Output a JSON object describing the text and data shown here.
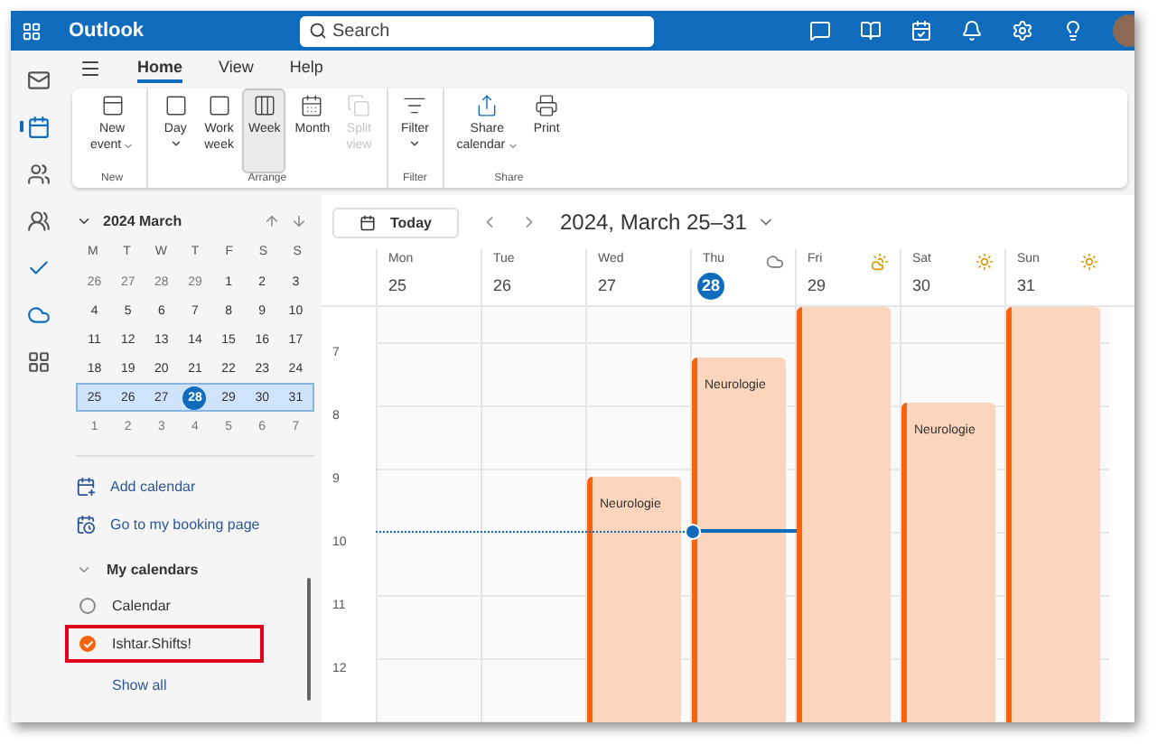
{
  "top_bar": {
    "app_name": "Outlook",
    "search": {
      "placeholder": "Search"
    }
  },
  "rail": [
    {
      "selected": false
    },
    {
      "selected": true
    },
    {
      "selected": false
    },
    {
      "selected": false
    },
    {
      "selected": false
    },
    {
      "selected": false
    },
    {
      "selected": false
    }
  ],
  "ribbon_tabs": [
    {
      "label": "Home",
      "selected": true
    },
    {
      "label": "View",
      "selected": false
    },
    {
      "label": "Help",
      "selected": false
    }
  ],
  "ribbon_groups": [
    {
      "label": "New",
      "buttons": [
        {
          "lines": [
            "New",
            "event"
          ],
          "dropdown": true,
          "selected": false,
          "disabled": false
        }
      ]
    },
    {
      "label": "Arrange",
      "buttons": [
        {
          "lines": [
            "Day"
          ],
          "dropdown": true,
          "selected": false,
          "disabled": false
        },
        {
          "lines": [
            "Work",
            "week"
          ],
          "dropdown": false,
          "selected": false,
          "disabled": false
        },
        {
          "lines": [
            "Week"
          ],
          "dropdown": false,
          "selected": true,
          "disabled": false
        },
        {
          "lines": [
            "Month"
          ],
          "dropdown": false,
          "selected": false,
          "disabled": false
        },
        {
          "lines": [
            "Split",
            "view"
          ],
          "dropdown": false,
          "selected": false,
          "disabled": true
        }
      ]
    },
    {
      "label": "Filter",
      "buttons": [
        {
          "lines": [
            "Filter"
          ],
          "dropdown": true,
          "selected": false,
          "disabled": false
        }
      ]
    },
    {
      "label": "Share",
      "buttons": [
        {
          "lines": [
            "Share",
            "calendar"
          ],
          "dropdown": true,
          "selected": false,
          "disabled": false
        },
        {
          "lines": [
            "Print"
          ],
          "dropdown": false,
          "selected": false,
          "disabled": false
        }
      ]
    }
  ],
  "mini_calendar": {
    "title": "2024 March",
    "weekdays": [
      "M",
      "T",
      "W",
      "T",
      "F",
      "S",
      "S"
    ],
    "weeks": [
      {
        "selected": false,
        "days": [
          {
            "label": "26",
            "other_month": true,
            "today": false
          },
          {
            "label": "27",
            "other_month": true,
            "today": false
          },
          {
            "label": "28",
            "other_month": true,
            "today": false
          },
          {
            "label": "29",
            "other_month": true,
            "today": false
          },
          {
            "label": "1",
            "other_month": false,
            "today": false
          },
          {
            "label": "2",
            "other_month": false,
            "today": false
          },
          {
            "label": "3",
            "other_month": false,
            "today": false
          }
        ]
      },
      {
        "selected": false,
        "days": [
          {
            "label": "4",
            "other_month": false,
            "today": false
          },
          {
            "label": "5",
            "other_month": false,
            "today": false
          },
          {
            "label": "6",
            "other_month": false,
            "today": false
          },
          {
            "label": "7",
            "other_month": false,
            "today": false
          },
          {
            "label": "8",
            "other_month": false,
            "today": false
          },
          {
            "label": "9",
            "other_month": false,
            "today": false
          },
          {
            "label": "10",
            "other_month": false,
            "today": false
          }
        ]
      },
      {
        "selected": false,
        "days": [
          {
            "label": "11",
            "other_month": false,
            "today": false
          },
          {
            "label": "12",
            "other_month": false,
            "today": false
          },
          {
            "label": "13",
            "other_month": false,
            "today": false
          },
          {
            "label": "14",
            "other_month": false,
            "today": false
          },
          {
            "label": "15",
            "other_month": false,
            "today": false
          },
          {
            "label": "16",
            "other_month": false,
            "today": false
          },
          {
            "label": "17",
            "other_month": false,
            "today": false
          }
        ]
      },
      {
        "selected": false,
        "days": [
          {
            "label": "18",
            "other_month": false,
            "today": false
          },
          {
            "label": "19",
            "other_month": false,
            "today": false
          },
          {
            "label": "20",
            "other_month": false,
            "today": false
          },
          {
            "label": "21",
            "other_month": false,
            "today": false
          },
          {
            "label": "22",
            "other_month": false,
            "today": false
          },
          {
            "label": "23",
            "other_month": false,
            "today": false
          },
          {
            "label": "24",
            "other_month": false,
            "today": false
          }
        ]
      },
      {
        "selected": true,
        "days": [
          {
            "label": "25",
            "other_month": false,
            "today": false
          },
          {
            "label": "26",
            "other_month": false,
            "today": false
          },
          {
            "label": "27",
            "other_month": false,
            "today": false
          },
          {
            "label": "28",
            "other_month": false,
            "today": true
          },
          {
            "label": "29",
            "other_month": false,
            "today": false
          },
          {
            "label": "30",
            "other_month": false,
            "today": false
          },
          {
            "label": "31",
            "other_month": false,
            "today": false
          }
        ]
      },
      {
        "selected": false,
        "days": [
          {
            "label": "1",
            "other_month": true,
            "today": false
          },
          {
            "label": "2",
            "other_month": true,
            "today": false
          },
          {
            "label": "3",
            "other_month": true,
            "today": false
          },
          {
            "label": "4",
            "other_month": true,
            "today": false
          },
          {
            "label": "5",
            "other_month": true,
            "today": false
          },
          {
            "label": "6",
            "other_month": true,
            "today": false
          },
          {
            "label": "7",
            "other_month": true,
            "today": false
          }
        ]
      }
    ]
  },
  "sidebar_links": [
    {
      "label": "Add calendar"
    },
    {
      "label": "Go to my booking page"
    }
  ],
  "my_calendars": {
    "title": "My calendars",
    "expanded": true,
    "items": [
      {
        "label": "Calendar",
        "checked": false,
        "highlighted": false,
        "color": "#8a8886"
      },
      {
        "label": "Ishtar.Shifts!",
        "checked": true,
        "highlighted": true,
        "color": "#f7630c"
      }
    ],
    "show_all": "Show all"
  },
  "toolbar": {
    "today": "Today",
    "range_title": "2024, March 25–31"
  },
  "week": {
    "hours": [
      "7",
      "8",
      "9",
      "10",
      "11",
      "12"
    ],
    "days": [
      {
        "weekday": "Mon",
        "date": "25",
        "today": false
      },
      {
        "weekday": "Tue",
        "date": "26",
        "today": false
      },
      {
        "weekday": "Wed",
        "date": "27",
        "today": false,
        "events": [
          {
            "title": "Neurologie",
            "level": 0.59
          }
        ]
      },
      {
        "weekday": "Thu",
        "date": "28",
        "today": true,
        "weather": {
          "kind": "cloud"
        },
        "events": [
          {
            "title": "Neurologie",
            "level": 0.88
          }
        ]
      },
      {
        "weekday": "Fri",
        "date": "29",
        "today": false,
        "weather": {
          "kind": "partly-sunny"
        },
        "events": [
          {
            "level": 1
          }
        ]
      },
      {
        "weekday": "Sat",
        "date": "30",
        "today": false,
        "weather": {
          "kind": "sunny"
        },
        "events": [
          {
            "title": "Neurologie",
            "level": 0.77
          }
        ]
      },
      {
        "weekday": "Sun",
        "date": "31",
        "today": false,
        "weather": {
          "kind": "sunny"
        },
        "events": [
          {
            "level": 1
          }
        ]
      }
    ]
  }
}
